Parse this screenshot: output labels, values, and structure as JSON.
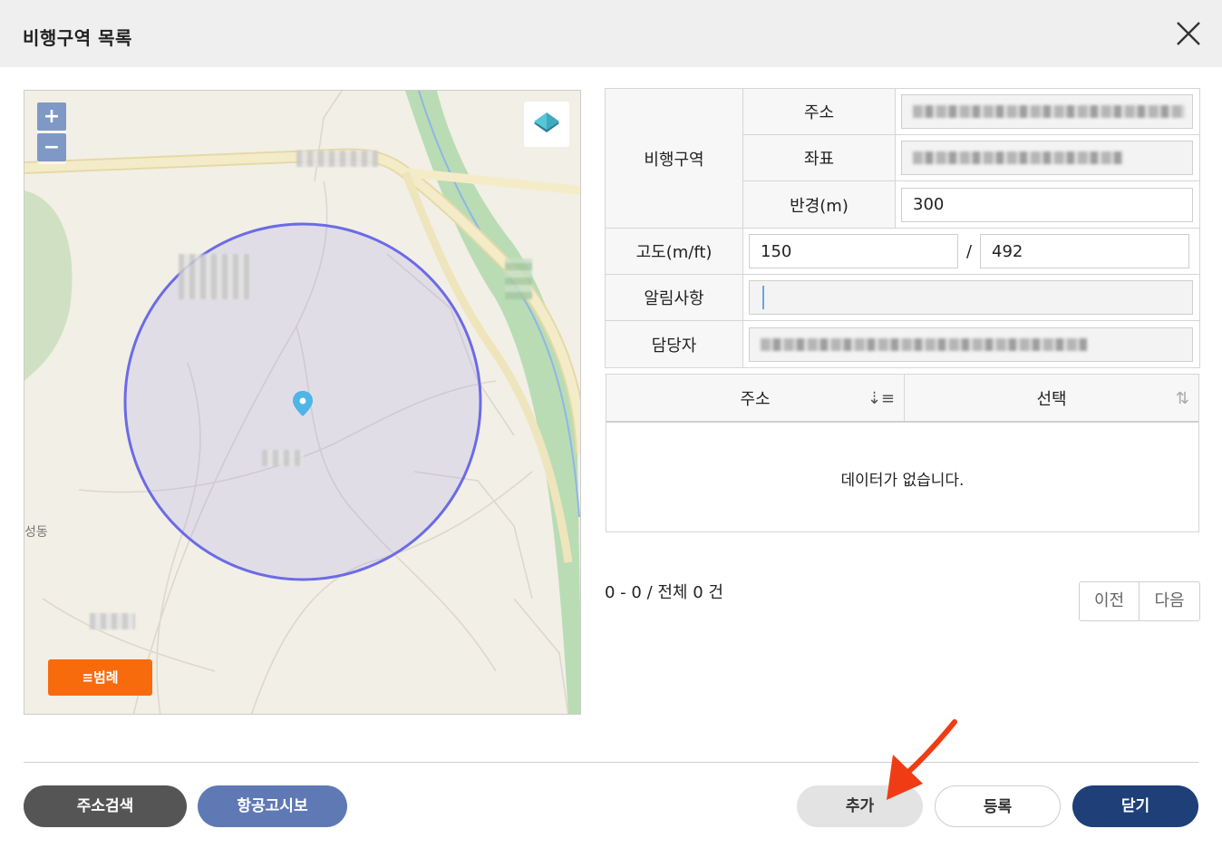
{
  "header": {
    "title": "비행구역 목록"
  },
  "map": {
    "zoom_in_label": "+",
    "zoom_out_label": "−",
    "legend_label": "≡범례",
    "place_label_partial": "성동",
    "circle_color": "#6b6be6",
    "marker_color": "#4fb4e6"
  },
  "form": {
    "zone_label": "비행구역",
    "address_label": "주소",
    "coord_label": "좌표",
    "radius_label": "반경(m)",
    "radius_value": "300",
    "altitude_label": "고도(m/ft)",
    "altitude_m": "150",
    "altitude_sep": "/",
    "altitude_ft": "492",
    "notice_label": "알림사항",
    "notice_value": "",
    "manager_label": "담당자"
  },
  "grid": {
    "columns": [
      "주소",
      "선택"
    ],
    "empty_text": "데이터가 없습니다."
  },
  "pagination": {
    "summary": "0 - 0 / 전체 0 건",
    "prev_label": "이전",
    "next_label": "다음"
  },
  "buttons": {
    "address_search": "주소검색",
    "notam": "항공고시보",
    "add": "추가",
    "register": "등록",
    "close": "닫기"
  },
  "colors": {
    "accent_orange": "#f86b0d",
    "navy": "#1e3f78",
    "annotation_arrow": "#f03c14"
  }
}
